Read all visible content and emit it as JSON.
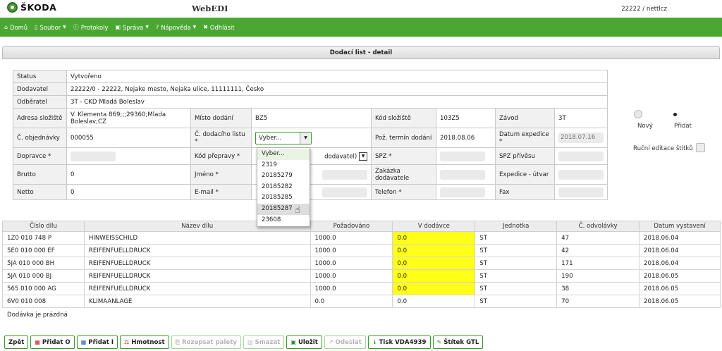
{
  "header": {
    "brand": "ŠKODA",
    "app_title": "WebEDI",
    "user": "22222 / nettlcz"
  },
  "nav": [
    {
      "label": "Domů",
      "icon": "home-icon",
      "caret": false
    },
    {
      "label": "Soubor",
      "icon": "file-icon",
      "caret": true
    },
    {
      "label": "Protokoly",
      "icon": "info-icon",
      "caret": false
    },
    {
      "label": "Správa",
      "icon": "admin-icon",
      "caret": true
    },
    {
      "label": "Nápověda",
      "icon": "help-icon",
      "caret": true
    },
    {
      "label": "Odhlásit",
      "icon": "logout-icon",
      "caret": false
    }
  ],
  "panel_title": "Dodací list - detail",
  "detail": {
    "status_label": "Status",
    "status_value": "Vytvořeno",
    "dodavatel_label": "Dodavatel",
    "dodavatel_value": "22222/0 - 22222, Nejake mesto, Nejaka ulice, 11111111, Česko",
    "odberatel_label": "Odběratel",
    "odberatel_value": "3T - CKD Mladá Boleslav",
    "adresa_label": "Adresa složiště",
    "adresa_value": "V. Klementa 869;;;29360;Mlada Boleslav;CZ",
    "misto_label": "Místo dodání",
    "misto_value": "BZ5",
    "kod_slozist_label": "Kód složiště",
    "kod_slozist_value": "103Z5",
    "zavod_label": "Závod",
    "zavod_value": "3T",
    "objednavky_label": "Č. objednávky",
    "objednavky_value": "000055",
    "dodaciho_label": "Č. dodacího listu *",
    "dodaciho_value": "Vyber...",
    "poz_termin_label": "Pož. termín dodání",
    "poz_termin_value": "2018.08.06",
    "datum_exp_label": "Datum expedice *",
    "datum_exp_value": "2018.07.16",
    "dopravce_label": "Dopravce *",
    "kod_prepravy_label": "Kód přepravy *",
    "kod_prepravy_value": "dodavatel)",
    "spz_label": "SPZ *",
    "spz_privesu_label": "SPZ přívěsu",
    "brutto_label": "Brutto",
    "brutto_value": "0",
    "jmeno_label": "Jméno *",
    "zakazka_label": "Zakázka dodavatele",
    "expedice_label": "Expedice - útvar",
    "netto_label": "Netto",
    "netto_value": "0",
    "email_label": "E-mail *",
    "telefon_label": "Telefon *",
    "fax_label": "Fax"
  },
  "dropdown_options": [
    "Vyber...",
    "2319",
    "20185279",
    "20185282",
    "20185285",
    "20185287",
    "23608"
  ],
  "side": {
    "novy": "Nový",
    "pridat": "Přidat",
    "rucni": "Ruční editace štítků"
  },
  "items": {
    "headers": [
      "Číslo dílu",
      "Název dílu",
      "Požadováno",
      "V dodávce",
      "Jednotka",
      "Č. odvolávky",
      "Datum vystavení"
    ],
    "rows": [
      [
        "1Z0 010 748 P",
        "HINWEISSCHILD",
        "1000.0",
        "0.0",
        "ST",
        "47",
        "2018.06.04"
      ],
      [
        "5E0 010 000 EF",
        "REIFENFUELLDRUCK",
        "1000.0",
        "0.0",
        "ST",
        "42",
        "2018.06.04"
      ],
      [
        "5JA 010 000 BH",
        "REIFENFUELLDRUCK",
        "1000.0",
        "0.0",
        "ST",
        "171",
        "2018.06.04"
      ],
      [
        "5JA 010 000 BJ",
        "REIFENFUELLDRUCK",
        "1000.0",
        "0.0",
        "ST",
        "190",
        "2018.06.05"
      ],
      [
        "565 010 000 AG",
        "REIFENFUELLDRUCK",
        "1000.0",
        "0.0",
        "ST",
        "38",
        "2018.06.05"
      ],
      [
        "6V0 010 008",
        "KLIMAANLAGE",
        "0.0",
        "0.0",
        "ST",
        "70",
        "2018.06.05"
      ]
    ]
  },
  "empty_note": "Dodávka je prázdná",
  "toolbar": {
    "zpet": "Zpět",
    "pridat_o": "Přidat O",
    "pridat_i": "Přidat I",
    "hmotnost": "Hmotnost",
    "rozepsat": "Rozepsat palety",
    "smazat": "Smazat",
    "ulozit": "Uložit",
    "odeslat": "Odeslat",
    "tisk": "Tisk VDA4939",
    "stitek": "Štítek GTL"
  },
  "colors": {
    "nav_green": "#4aa832",
    "highlight_yellow": "#ffff1a"
  }
}
